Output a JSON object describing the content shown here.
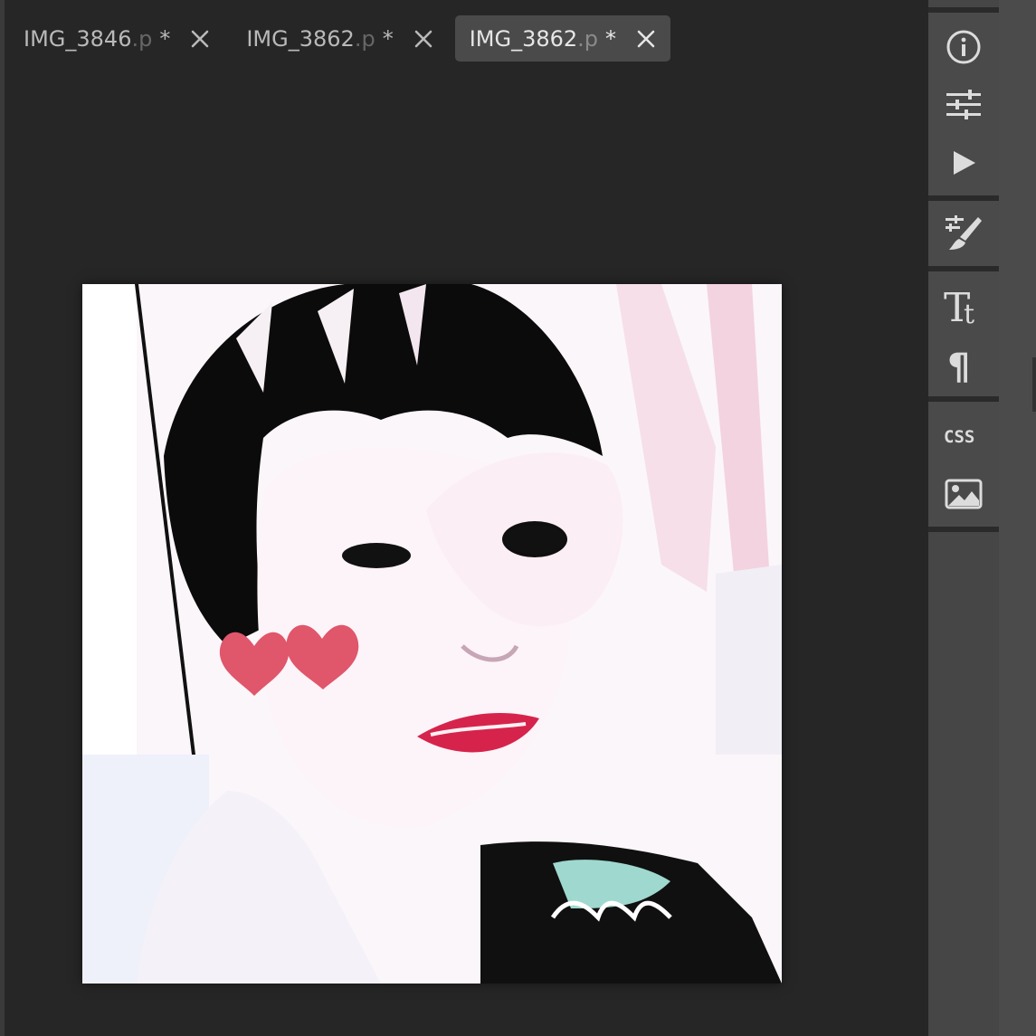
{
  "tabs": [
    {
      "name": "IMG_3846",
      "ext": ".p",
      "modified": "*",
      "active": false
    },
    {
      "name": "IMG_3862",
      "ext": ".p",
      "modified": "*",
      "active": false
    },
    {
      "name": "IMG_3862",
      "ext": ".p",
      "modified": "*",
      "active": true
    }
  ],
  "sidebar": {
    "tools": [
      {
        "id": "info",
        "icon": "info-icon"
      },
      {
        "id": "adjustments",
        "icon": "sliders-icon"
      },
      {
        "id": "play",
        "icon": "play-icon"
      },
      {
        "id": "brush-settings",
        "icon": "brush-settings-icon"
      },
      {
        "id": "text",
        "icon": "text-tt-icon"
      },
      {
        "id": "paragraph",
        "icon": "paragraph-icon"
      },
      {
        "id": "css",
        "icon": "css-icon",
        "label": "CSS"
      },
      {
        "id": "image",
        "icon": "image-icon"
      }
    ]
  },
  "colors": {
    "background": "#262626",
    "tab_active": "#4a4a4a",
    "sidebar": "#4a4a4a",
    "heart": "#e0566b",
    "lips": "#d6234c"
  }
}
